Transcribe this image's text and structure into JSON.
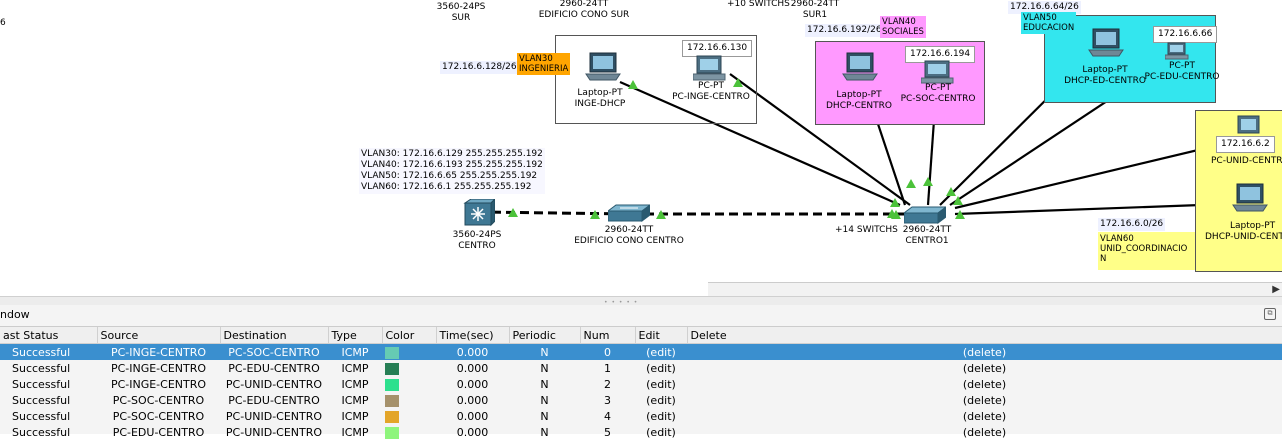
{
  "topology": {
    "top_labels": {
      "edge_6": "6",
      "sw3560_sur_model": "3560-24PS",
      "sw3560_sur_name": "SUR",
      "sw_cono_sur_model": "2960-24TT",
      "sw_cono_sur_name": "EDIFICIO CONO SUR",
      "sur1_switches": "+10 SWITCHS",
      "sur1_model": "2960-24TT",
      "sur1_name": "SUR1"
    },
    "vlan30": {
      "label_1": "VLAN30",
      "label_2": "INGENIERIA",
      "subnet": "172.16.6.128/26",
      "color": "#ffa500",
      "laptop_model": "Laptop-PT",
      "laptop_name": "INGE-DHCP",
      "pc_model": "PC-PT",
      "pc_name": "PC-INGE-CENTRO",
      "pc_ip": "172.16.6.130"
    },
    "vlan40": {
      "label_1": "VLAN40",
      "label_2": "SOCIALES",
      "subnet": "172.16.6.192/26",
      "color": "#ff99ff",
      "laptop_model": "Laptop-PT",
      "laptop_name": "DHCP-CENTRO",
      "pc_model": "PC-PT",
      "pc_name": "PC-SOC-CENTRO",
      "pc_ip": "172.16.6.194"
    },
    "vlan50": {
      "label_1": "VLAN50",
      "label_2": "EDUCACION",
      "subnet": "172.16.6.64/26",
      "color": "#33e6ee",
      "laptop_model": "Laptop-PT",
      "laptop_name": "DHCP-ED-CENTRO",
      "pc_model": "PC-PT",
      "pc_name": "PC-EDU-CENTRO",
      "pc_ip": "172.16.6.66"
    },
    "vlan60": {
      "label_1": "VLAN60",
      "label_2": "UNID_COORDINACIO",
      "label_3": "N",
      "subnet": "172.16.6.0/26",
      "color": "#ffff88",
      "pc_ip": "172.16.6.2",
      "pc_name": "PC-UNID-CENTR",
      "laptop_model": "Laptop-PT",
      "laptop_name": "DHCP-UNID-CENT"
    },
    "interfaces": [
      "VLAN30: 172.16.6.129 255.255.255.192",
      "VLAN40: 172.16.6.193 255.255.255.192",
      "VLAN50: 172.16.6.65 255.255.255.192",
      "VLAN60: 172.16.6.1 255.255.255.192"
    ],
    "core": {
      "model": "3560-24PS",
      "name": "CENTRO"
    },
    "cono_centro": {
      "model": "2960-24TT",
      "name": "EDIFICIO CONO CENTRO"
    },
    "centro1": {
      "switches": "+14 SWITCHS",
      "model": "2960-24TT",
      "name": "CENTRO1"
    }
  },
  "pdu_window": {
    "title": "ndow",
    "columns": [
      "ast Status",
      "Source",
      "Destination",
      "Type",
      "Color",
      "Time(sec)",
      "Periodic",
      "Num",
      "Edit",
      "Delete"
    ],
    "rows": [
      {
        "status": "Successful",
        "source": "PC-INGE-CENTRO",
        "destination": "PC-SOC-CENTRO",
        "type": "ICMP",
        "color": "#66cbb3",
        "time": "0.000",
        "periodic": "N",
        "num": "0",
        "edit": "(edit)",
        "delete": "(delete)"
      },
      {
        "status": "Successful",
        "source": "PC-INGE-CENTRO",
        "destination": "PC-EDU-CENTRO",
        "type": "ICMP",
        "color": "#267e55",
        "time": "0.000",
        "periodic": "N",
        "num": "1",
        "edit": "(edit)",
        "delete": "(delete)"
      },
      {
        "status": "Successful",
        "source": "PC-INGE-CENTRO",
        "destination": "PC-UNID-CENTRO",
        "type": "ICMP",
        "color": "#2de08e",
        "time": "0.000",
        "periodic": "N",
        "num": "2",
        "edit": "(edit)",
        "delete": "(delete)"
      },
      {
        "status": "Successful",
        "source": "PC-SOC-CENTRO",
        "destination": "PC-EDU-CENTRO",
        "type": "ICMP",
        "color": "#a5916b",
        "time": "0.000",
        "periodic": "N",
        "num": "3",
        "edit": "(edit)",
        "delete": "(delete)"
      },
      {
        "status": "Successful",
        "source": "PC-SOC-CENTRO",
        "destination": "PC-UNID-CENTRO",
        "type": "ICMP",
        "color": "#e3a529",
        "time": "0.000",
        "periodic": "N",
        "num": "4",
        "edit": "(edit)",
        "delete": "(delete)"
      },
      {
        "status": "Successful",
        "source": "PC-EDU-CENTRO",
        "destination": "PC-UNID-CENTRO",
        "type": "ICMP",
        "color": "#8ef57c",
        "time": "0.000",
        "periodic": "N",
        "num": "5",
        "edit": "(edit)",
        "delete": "(delete)"
      }
    ]
  }
}
